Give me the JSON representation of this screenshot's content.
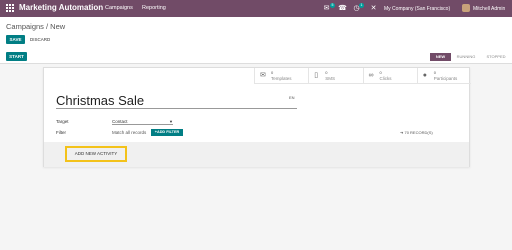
{
  "navbar": {
    "app_title": "Marketing Automation",
    "menu": [
      "Campaigns",
      "Reporting"
    ],
    "chat_count": "5",
    "activity_count": "1",
    "company": "My Company (San Francisco)",
    "user": "Mitchell Admin",
    "icons": [
      "apps-icon",
      "chat-icon",
      "phone-icon",
      "activity-icon",
      "close-icon"
    ],
    "brand_color": "#714b67"
  },
  "control_panel": {
    "breadcrumb": "Campaigns / New",
    "save_label": "SAVE",
    "discard_label": "DISCARD"
  },
  "statusbar": {
    "start_label": "START",
    "stages": [
      "NEW",
      "RUNNING",
      "STOPPED"
    ],
    "active_stage": "NEW",
    "accent_color": "#017e84"
  },
  "form": {
    "stats": [
      {
        "icon": "envelope-icon",
        "value": "0",
        "label": "Templates"
      },
      {
        "icon": "mobile-icon",
        "value": "0",
        "label": "SMS"
      },
      {
        "icon": "link-icon",
        "value": "0",
        "label": "Clicks"
      },
      {
        "icon": "users-icon",
        "value": "0",
        "label": "Participants"
      }
    ],
    "name": "Christmas Sale",
    "lang": "EN",
    "target_label": "Target",
    "target_value": "Contact",
    "filter_label": "Filter",
    "filter_text": "Match all records",
    "add_filter_label": "ADD FILTER",
    "records_text": "70 RECORD(S)",
    "add_activity_label": "ADD NEW ACTIVITY",
    "highlight_color": "#f3c21a"
  }
}
